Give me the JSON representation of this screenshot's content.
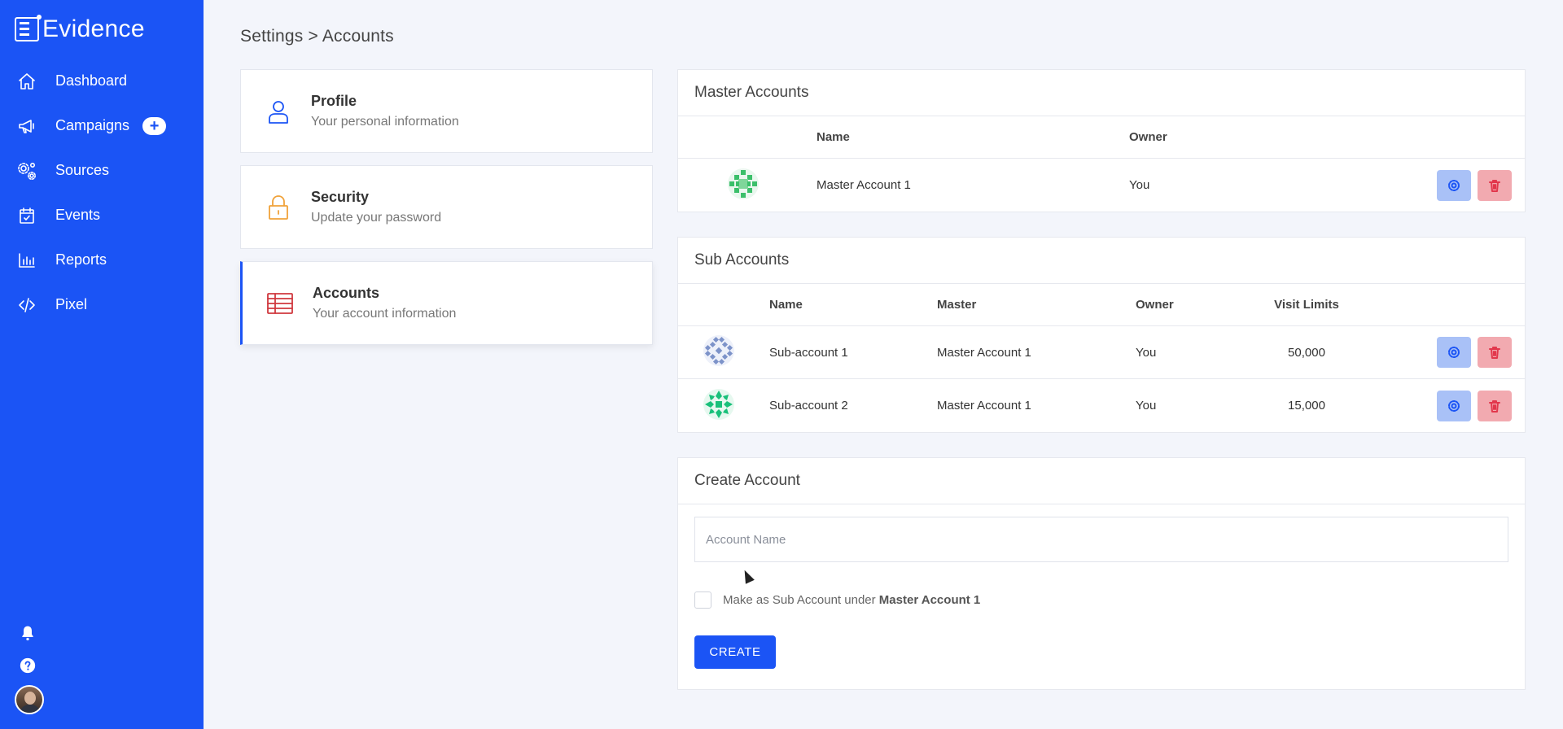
{
  "brand": {
    "name": "Evidence"
  },
  "sidebar": {
    "items": [
      {
        "label": "Dashboard",
        "icon": "home-icon"
      },
      {
        "label": "Campaigns",
        "icon": "megaphone-icon",
        "badge": "+"
      },
      {
        "label": "Sources",
        "icon": "gears-icon"
      },
      {
        "label": "Events",
        "icon": "calendar-check-icon"
      },
      {
        "label": "Reports",
        "icon": "bar-chart-icon"
      },
      {
        "label": "Pixel",
        "icon": "code-icon"
      }
    ],
    "bottom": [
      "bell-icon",
      "help-icon",
      "avatar"
    ]
  },
  "breadcrumb": "Settings > Accounts",
  "settings": [
    {
      "title": "Profile",
      "subtitle": "Your personal information",
      "icon": "user-icon",
      "color": "#1b54f5"
    },
    {
      "title": "Security",
      "subtitle": "Update your password",
      "icon": "lock-icon",
      "color": "#f0a23a"
    },
    {
      "title": "Accounts",
      "subtitle": "Your account information",
      "icon": "table-icon",
      "color": "#d0393f",
      "active": true
    }
  ],
  "master_accounts": {
    "title": "Master Accounts",
    "columns": [
      "Name",
      "Owner"
    ],
    "rows": [
      {
        "name": "Master Account 1",
        "owner": "You"
      }
    ]
  },
  "sub_accounts": {
    "title": "Sub Accounts",
    "columns": [
      "Name",
      "Master",
      "Owner",
      "Visit Limits"
    ],
    "rows": [
      {
        "name": "Sub-account 1",
        "master": "Master Account 1",
        "owner": "You",
        "limit": "50,000"
      },
      {
        "name": "Sub-account 2",
        "master": "Master Account 1",
        "owner": "You",
        "limit": "15,000"
      }
    ]
  },
  "create_account": {
    "title": "Create Account",
    "input_placeholder": "Account Name",
    "checkbox_label": "Make as Sub Account under",
    "checkbox_target": "Master Account 1",
    "button_label": "CREATE"
  },
  "colors": {
    "primary": "#1b54f5",
    "danger": "#e2374c",
    "background": "#f3f5fb"
  }
}
